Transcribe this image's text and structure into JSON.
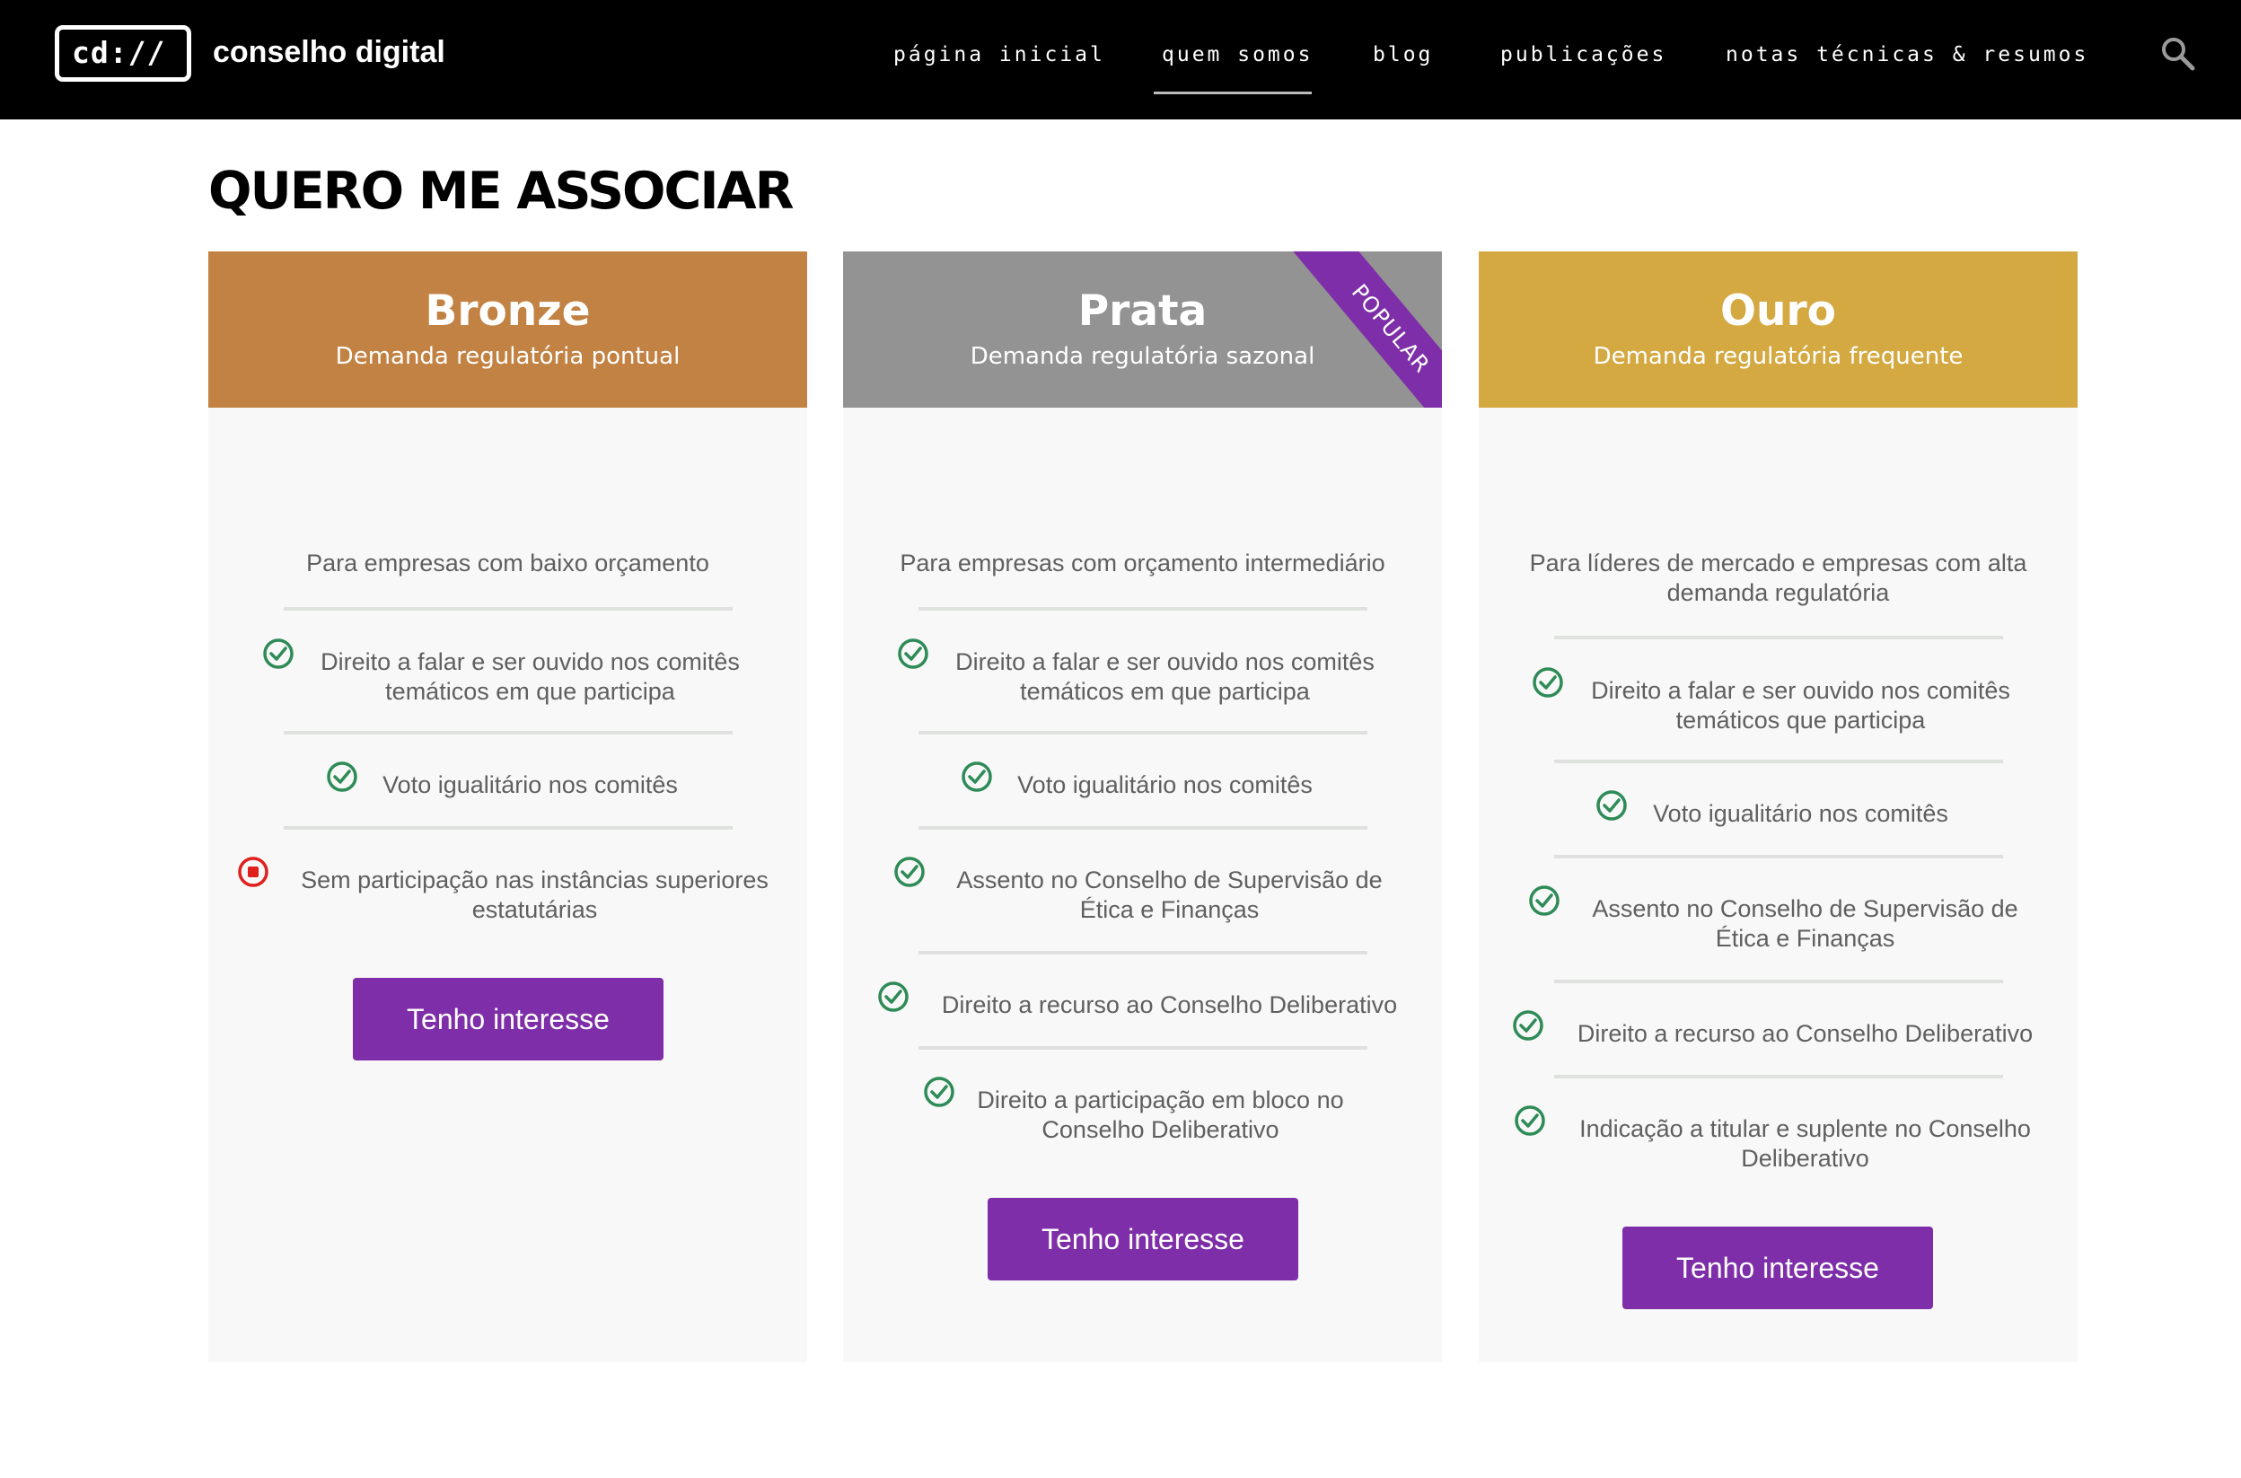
{
  "header": {
    "logo_mark": "cd://",
    "logo_text": "conselho digital",
    "nav": [
      "página inicial",
      "quem somos",
      "blog",
      "publicações",
      "notas técnicas & resumos"
    ],
    "active_nav": "quem somos",
    "search_icon": "search-icon"
  },
  "main": {
    "title": "QUERO ME ASSOCIAR",
    "cards": [
      {
        "name": "Bronze",
        "subtitle": "Demanda regulatória pontual",
        "header_color": "#c28243",
        "intro": "Para empresas com baixo orçamento",
        "features": [
          {
            "text": "Direito a falar e ser ouvido nos comitês temáticos em que participa",
            "status": "check"
          },
          {
            "text": "Voto igualitário nos comitês",
            "status": "check"
          },
          {
            "text": "Sem participação nas instâncias superiores estatutárias",
            "status": "cross"
          }
        ],
        "button": "Tenho interesse"
      },
      {
        "name": "Prata",
        "subtitle": "Demanda regulatória sazonal",
        "header_color": "#939393",
        "ribbon": "POPULAR",
        "intro": "Para empresas com orçamento intermediário",
        "features": [
          {
            "text": "Direito a falar e ser ouvido nos comitês temáticos em que participa",
            "status": "check"
          },
          {
            "text": "Voto igualitário nos comitês",
            "status": "check"
          },
          {
            "text": "Assento no Conselho de Supervisão de Ética e Finanças",
            "status": "check"
          },
          {
            "text": "Direito a recurso ao Conselho Deliberativo",
            "status": "check"
          },
          {
            "text": "Direito a participação em bloco no Conselho Deliberativo",
            "status": "check"
          }
        ],
        "button": "Tenho interesse"
      },
      {
        "name": "Ouro",
        "subtitle": "Demanda regulatória frequente",
        "header_color": "#d4a942",
        "intro": "Para líderes de mercado e empresas com alta demanda regulatória",
        "features": [
          {
            "text": "Direito a falar e ser ouvido nos comitês temáticos que participa",
            "status": "check"
          },
          {
            "text": "Voto igualitário nos comitês",
            "status": "check"
          },
          {
            "text": "Assento no Conselho de Supervisão de Ética e Finanças",
            "status": "check"
          },
          {
            "text": "Direito a recurso ao Conselho Deliberativo",
            "status": "check"
          },
          {
            "text": "Indicação a titular e suplente no Conselho Deliberativo",
            "status": "check"
          }
        ],
        "button": "Tenho interesse"
      }
    ],
    "colors": {
      "check": "#2e8b57",
      "cross": "#e0201c",
      "button": "#7e2ea8"
    }
  }
}
